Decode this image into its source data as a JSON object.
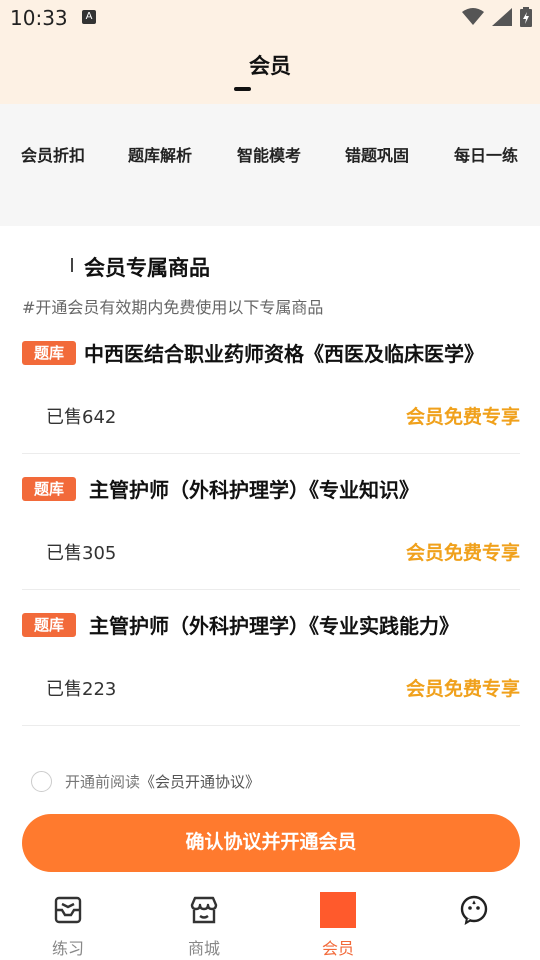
{
  "status": {
    "time": "10:33",
    "indicator": "A"
  },
  "header": {
    "title": "会员"
  },
  "features": [
    "会员折扣",
    "题库解析",
    "智能模考",
    "错题巩固",
    "每日一练"
  ],
  "section": {
    "title": "会员专属商品",
    "subtitle": "#开通会员有效期内免费使用以下专属商品"
  },
  "products": [
    {
      "tag": "题库",
      "name": "中西医结合职业药师资格《西医及临床医学》",
      "sold": "已售642",
      "price_label": "会员免费专享"
    },
    {
      "tag": "题库",
      "name": "主管护师（外科护理学）《专业知识》",
      "sold": "已售305",
      "price_label": "会员免费专享"
    },
    {
      "tag": "题库",
      "name": "主管护师（外科护理学）《专业实践能力》",
      "sold": "已售223",
      "price_label": "会员免费专享"
    }
  ],
  "agreement": {
    "prefix": "开通前阅读",
    "link": "《会员开通协议》"
  },
  "confirm_button": "确认协议并开通会员",
  "tabs": [
    {
      "label": "练习",
      "icon": "inbox-icon"
    },
    {
      "label": "商城",
      "icon": "store-icon"
    },
    {
      "label": "会员",
      "icon": "member-icon",
      "active": true
    },
    {
      "label": "",
      "icon": "chat-bubble-icon"
    }
  ],
  "colors": {
    "accent": "#f26a3a",
    "button": "#ff7a2e",
    "gold": "#f0a11c",
    "header_bg": "#fdf1e4"
  }
}
